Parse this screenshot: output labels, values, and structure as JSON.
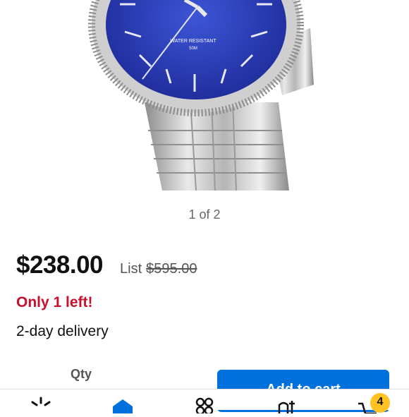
{
  "gallery": {
    "counter": "1 of 2"
  },
  "watch_dial": {
    "line1": "WATER RESISTANT",
    "line2": "50M"
  },
  "price": {
    "current": "$238.00",
    "list_label": "List",
    "list_value": "$595.00"
  },
  "stock": {
    "message": "Only 1 left!"
  },
  "delivery": {
    "text": "2-day delivery"
  },
  "quantity": {
    "label": "Qty"
  },
  "cart_button": {
    "label": "Add to cart"
  },
  "bottom_nav": {
    "items": [
      {
        "icon": "spark-icon"
      },
      {
        "icon": "home-icon"
      },
      {
        "icon": "departments-icon"
      },
      {
        "icon": "services-icon"
      },
      {
        "icon": "cart-icon"
      }
    ],
    "cart_count": "4"
  },
  "colors": {
    "accent": "#0071dc",
    "alert": "#c8102e",
    "badge": "#ffc220",
    "dial": "#2a3fb8"
  }
}
